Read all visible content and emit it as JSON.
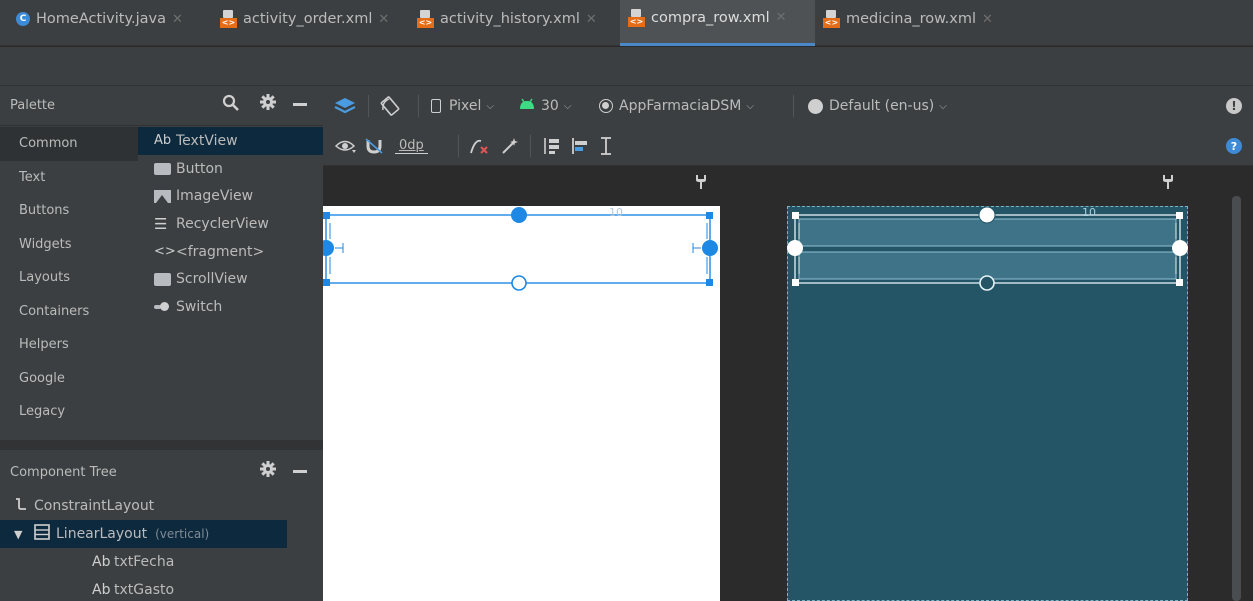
{
  "tabs": [
    {
      "label": "HomeActivity.java",
      "icon": "java-class-icon",
      "active": false
    },
    {
      "label": "activity_order.xml",
      "icon": "xml-layout-icon",
      "active": false
    },
    {
      "label": "activity_history.xml",
      "icon": "xml-layout-icon",
      "active": false
    },
    {
      "label": "compra_row.xml",
      "icon": "xml-layout-icon",
      "active": true
    },
    {
      "label": "medicina_row.xml",
      "icon": "xml-layout-icon",
      "active": false
    }
  ],
  "palette": {
    "title": "Palette",
    "categories": [
      "Common",
      "Text",
      "Buttons",
      "Widgets",
      "Layouts",
      "Containers",
      "Helpers",
      "Google",
      "Legacy"
    ],
    "selected_category": "Common",
    "items": [
      {
        "icon_text": "Ab",
        "label": "TextView"
      },
      {
        "label": "Button"
      },
      {
        "label": "ImageView"
      },
      {
        "icon_text": "☰",
        "label": "RecyclerView"
      },
      {
        "icon_text": "<>",
        "label": "<fragment>"
      },
      {
        "label": "ScrollView"
      },
      {
        "label": "Switch"
      }
    ]
  },
  "component_tree": {
    "title": "Component Tree",
    "rows": [
      {
        "label": "ConstraintLayout",
        "sub": ""
      },
      {
        "label": "LinearLayout",
        "sub": "(vertical)"
      },
      {
        "icon_text": "Ab",
        "label": "txtFecha"
      },
      {
        "icon_text": "Ab",
        "label": "txtGasto"
      }
    ]
  },
  "toolbar": {
    "device": "Pixel",
    "api": "30",
    "theme": "AppFarmaciaDSM",
    "locale": "Default (en-us)",
    "margin": "0dp",
    "warning_glyph": "!",
    "help_glyph": "?"
  },
  "canvas": {
    "margin_label": "10"
  },
  "colors": {
    "accent": "#4a88c7",
    "blueprint": "#235566",
    "selection": "#1e88e5",
    "xml_icon": "#e66d17",
    "android_green": "#3ddc84"
  }
}
